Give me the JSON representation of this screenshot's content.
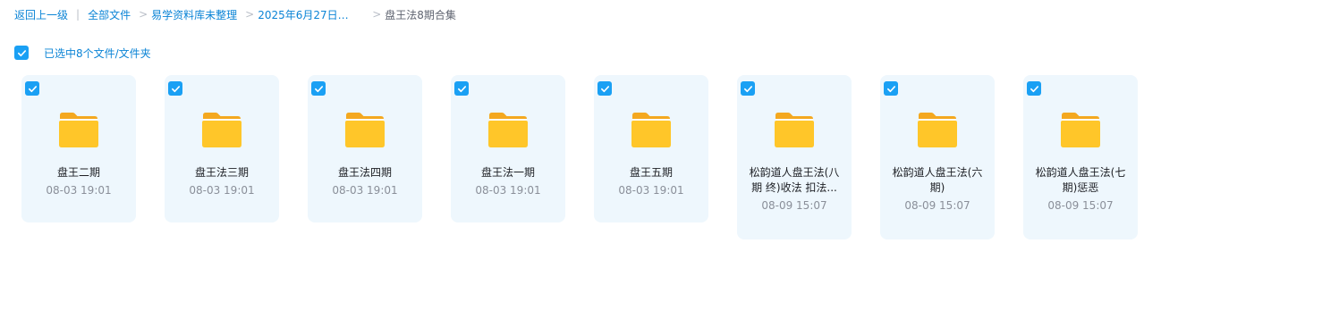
{
  "breadcrumb": {
    "back": "返回上一级",
    "items": [
      "全部文件",
      "易学资料库未整理",
      "2025年6月27日课..."
    ],
    "current": "盘王法8期合集"
  },
  "selection": {
    "label": "已选中8个文件/文件夹",
    "all_checked": true
  },
  "colors": {
    "accent": "#1aa0f4",
    "link": "#0b84d6",
    "card_bg": "#eef7fd",
    "folder": "#ffc629"
  },
  "files": [
    {
      "name": "盘王二期",
      "time": "08-03 19:01",
      "icon": "folder-icon",
      "checked": true
    },
    {
      "name": "盘王法三期",
      "time": "08-03 19:01",
      "icon": "folder-icon",
      "checked": true
    },
    {
      "name": "盘王法四期",
      "time": "08-03 19:01",
      "icon": "folder-icon",
      "checked": true
    },
    {
      "name": "盘王法一期",
      "time": "08-03 19:01",
      "icon": "folder-icon",
      "checked": true
    },
    {
      "name": "盘王五期",
      "time": "08-03 19:01",
      "icon": "folder-icon",
      "checked": true
    },
    {
      "name": "松韵道人盘王法(八期 终)收法 扣法...",
      "time": "08-09 15:07",
      "icon": "folder-icon",
      "checked": true
    },
    {
      "name": "松韵道人盘王法(六期)",
      "time": "08-09 15:07",
      "icon": "folder-icon",
      "checked": true
    },
    {
      "name": "松韵道人盘王法(七期)惩恶",
      "time": "08-09 15:07",
      "icon": "folder-icon",
      "checked": true
    }
  ]
}
